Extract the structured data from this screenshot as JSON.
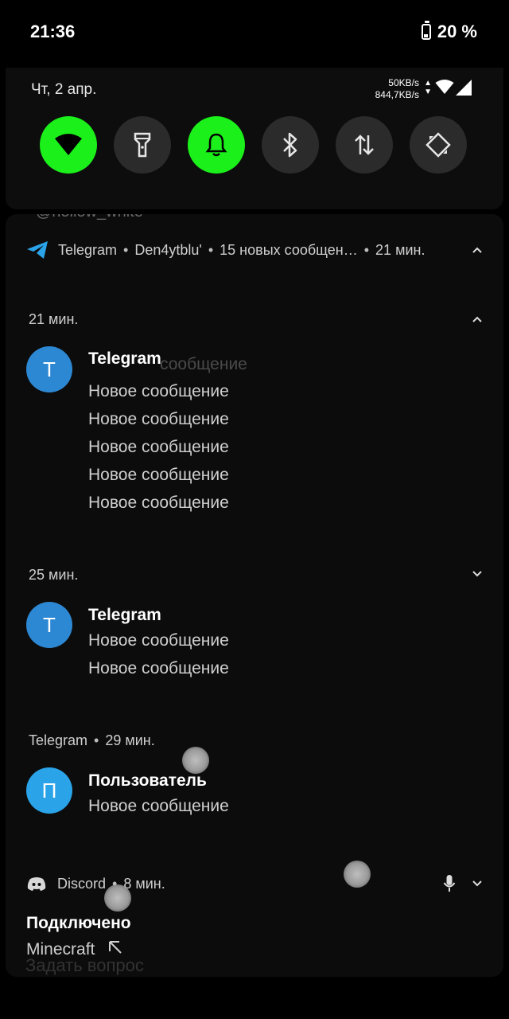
{
  "status_bar": {
    "time": "21:36",
    "battery": "20 %"
  },
  "quick_settings": {
    "date": "Чт, 2 апр.",
    "net_up": "50KB/s",
    "net_down": "844,7KB/s",
    "tiles": [
      {
        "name": "wifi",
        "state": "on"
      },
      {
        "name": "flashlight",
        "state": "off"
      },
      {
        "name": "notifications",
        "state": "on"
      },
      {
        "name": "bluetooth",
        "state": "off"
      },
      {
        "name": "mobile-data",
        "state": "off"
      },
      {
        "name": "auto-rotate",
        "state": "off"
      }
    ],
    "colors": {
      "tile_on": "#1bf01b",
      "tile_off": "#2b2b2b"
    }
  },
  "telegram_header": {
    "app": "Telegram",
    "account": "Den4ytblu'",
    "summary": "15 новых сообщен…",
    "time": "21 мин."
  },
  "scroll_ghost": "@hollow_white",
  "groups": [
    {
      "time": "21 мин.",
      "avatar": "T",
      "title": "Telegram",
      "ghost": "сообщение",
      "messages": [
        "Новое сообщение",
        "Новое сообщение",
        "Новое сообщение",
        "Новое сообщение",
        "Новое сообщение"
      ]
    },
    {
      "time": "25 мин.",
      "avatar": "T",
      "title": "Telegram",
      "messages": [
        "Новое сообщение",
        "Новое сообщение"
      ]
    },
    {
      "app": "Telegram",
      "time": "29 мин.",
      "avatar": "П",
      "title": "Пользователь",
      "messages": [
        "Новое сообщение"
      ]
    }
  ],
  "discord": {
    "app": "Discord",
    "time": "8 мин.",
    "title": "Подключено",
    "subtitle": "Minecraft"
  },
  "bottom_ghost": "Задать вопрос"
}
